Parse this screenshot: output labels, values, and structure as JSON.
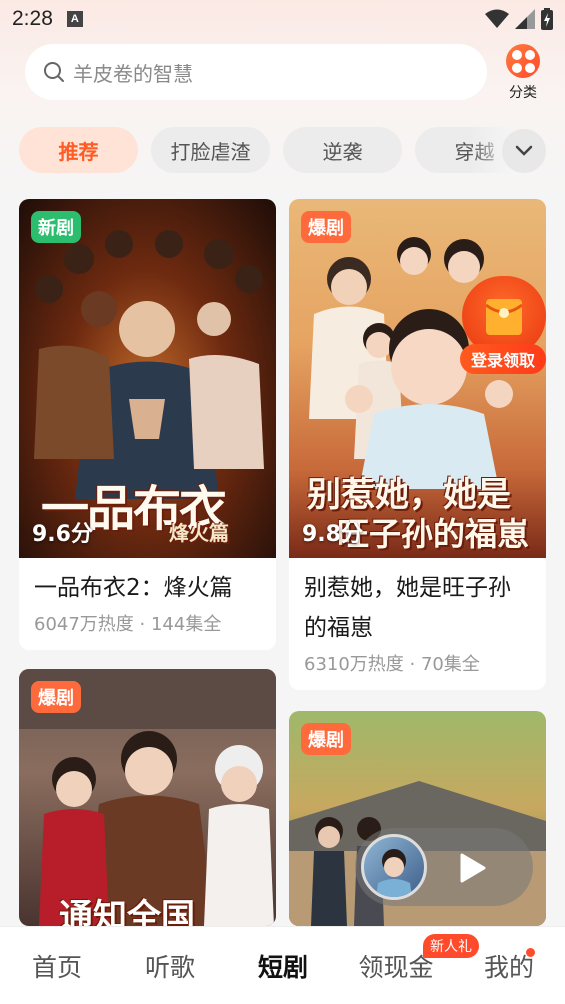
{
  "status_bar": {
    "time": "2:28",
    "notif_letter": "A"
  },
  "search": {
    "placeholder": "羊皮卷的智慧"
  },
  "category_button": {
    "label": "分类"
  },
  "tabs": [
    {
      "label": "推荐",
      "active": true
    },
    {
      "label": "打脸虐渣",
      "active": false
    },
    {
      "label": "逆袭",
      "active": false
    },
    {
      "label": "穿越",
      "active": false
    }
  ],
  "cards": [
    {
      "badge": "新剧",
      "badge_color": "#2dbd6e",
      "score": "9.6分",
      "poster_text": "一品布衣",
      "poster_sub": "烽火篇",
      "title": "一品布衣2：烽火篇",
      "meta": "6047万热度 · 144集全"
    },
    {
      "badge": "爆剧",
      "badge_color": "#ff6a3d",
      "score": "9.8分",
      "poster_text": "别惹她，她是",
      "poster_sub": "旺子孙的福崽",
      "title": "别惹她，她是旺子孙的福崽",
      "meta": "6310万热度 · 70集全"
    },
    {
      "badge": "爆剧",
      "badge_color": "#ff6a3d",
      "poster_text": "通知全国"
    },
    {
      "badge": "爆剧",
      "badge_color": "#ff6a3d"
    }
  ],
  "reward": {
    "label": "登录领取"
  },
  "bottom_nav": [
    {
      "label": "首页",
      "active": false
    },
    {
      "label": "听歌",
      "active": false
    },
    {
      "label": "短剧",
      "active": true
    },
    {
      "label": "领现金",
      "active": false
    },
    {
      "label": "我的",
      "active": false
    }
  ],
  "nav_badge": "新人礼",
  "colors": {
    "accent": "#ff5b24",
    "badge_green": "#2dbd6e",
    "badge_orange": "#ff6a3d"
  }
}
